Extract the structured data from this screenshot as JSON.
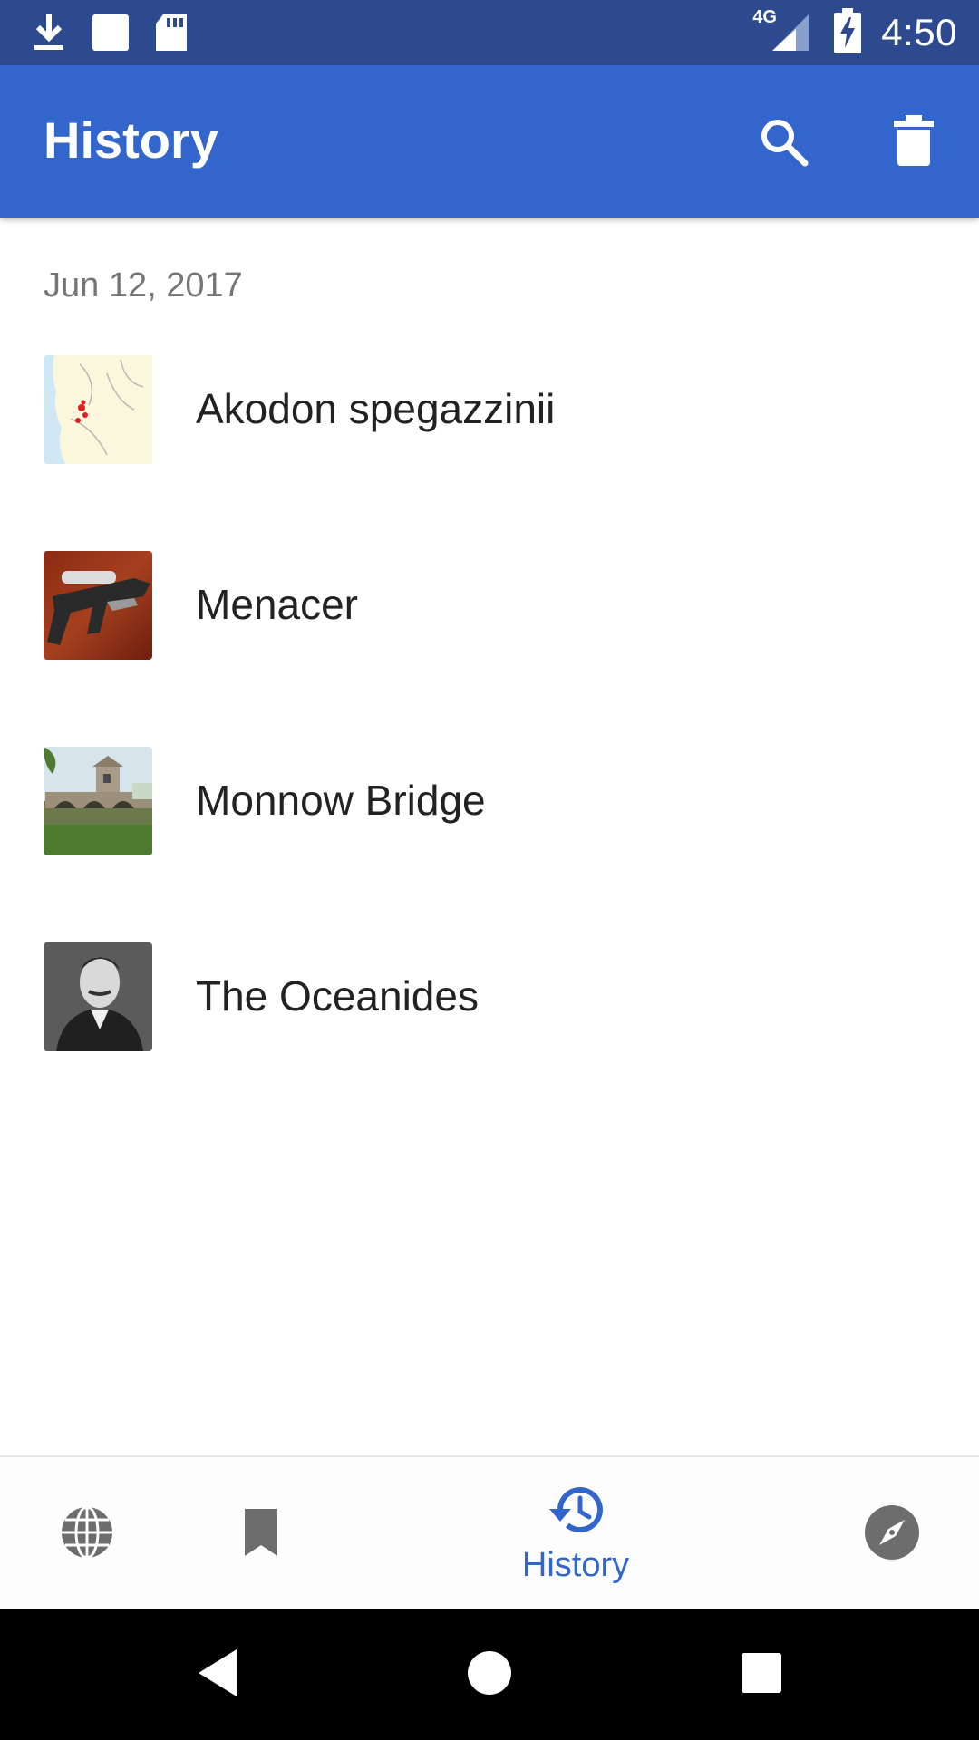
{
  "status_bar": {
    "time": "4:50",
    "network": "4G",
    "icons": [
      "download-icon",
      "image-icon",
      "sd-card-icon",
      "signal-icon",
      "battery-charging-icon"
    ]
  },
  "app_bar": {
    "title": "History",
    "actions": [
      "search-icon",
      "delete-icon"
    ]
  },
  "history": {
    "date": "Jun 12, 2017",
    "items": [
      {
        "title": "Akodon spegazzinii",
        "thumb": "range-map-thumbnail"
      },
      {
        "title": "Menacer",
        "thumb": "menacer-photo-thumbnail"
      },
      {
        "title": "Monnow Bridge",
        "thumb": "bridge-photo-thumbnail"
      },
      {
        "title": "The Oceanides",
        "thumb": "portrait-photo-thumbnail"
      }
    ]
  },
  "bottom_nav": {
    "items": [
      {
        "icon": "globe-icon"
      },
      {
        "icon": "bookmark-icon"
      },
      {
        "icon": "history-icon",
        "label": "History",
        "active": true
      },
      {
        "icon": "compass-icon"
      }
    ]
  },
  "colors": {
    "status_bar": "#2c4a8d",
    "app_bar": "#3366cc",
    "accent": "#3366cc",
    "text_primary": "#222222",
    "text_secondary": "#757575"
  }
}
